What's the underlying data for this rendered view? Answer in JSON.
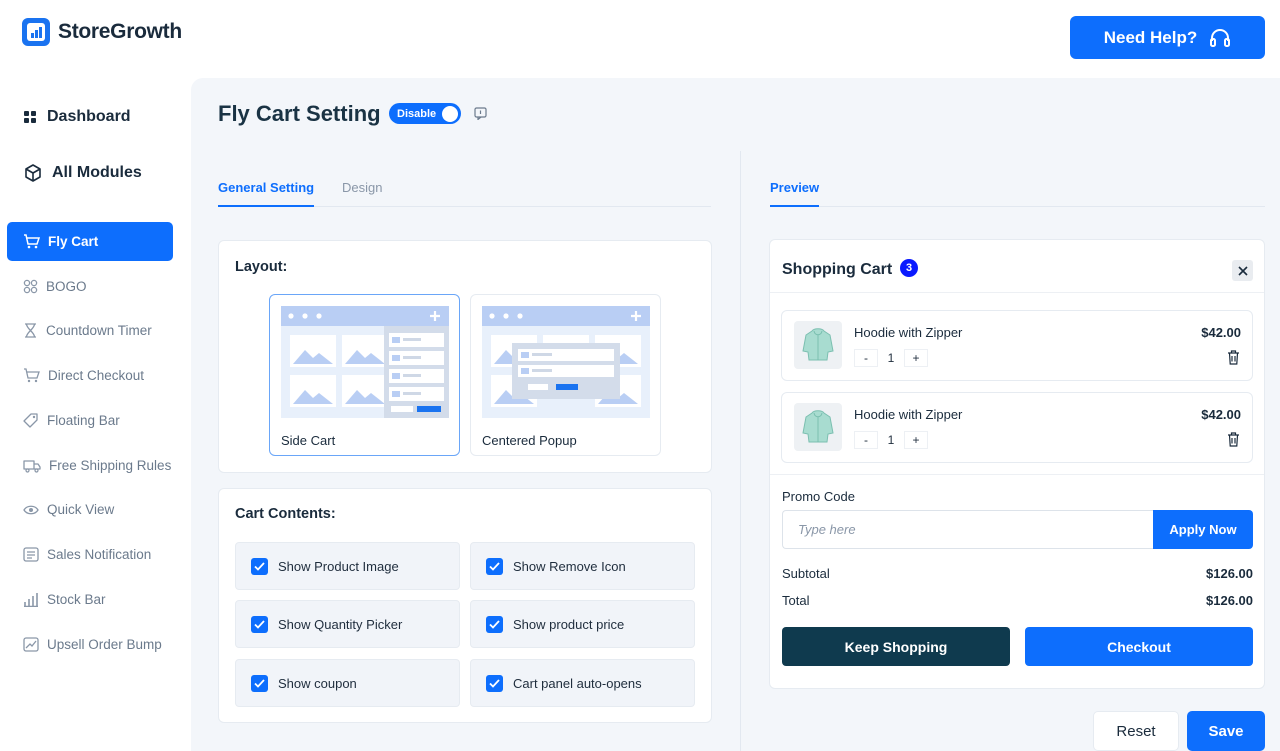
{
  "app": {
    "name": "StoreGrowth"
  },
  "header": {
    "help_label": "Need Help?"
  },
  "sidebar": {
    "dashboard": "Dashboard",
    "all_modules": "All Modules",
    "items": [
      {
        "label": "Fly Cart",
        "icon": "cart-icon",
        "active": true
      },
      {
        "label": "BOGO",
        "icon": "bogo-icon"
      },
      {
        "label": "Countdown Timer",
        "icon": "hourglass-icon"
      },
      {
        "label": "Direct Checkout",
        "icon": "checkout-cart-icon"
      },
      {
        "label": "Floating Bar",
        "icon": "tag-icon"
      },
      {
        "label": "Free Shipping Rules",
        "icon": "truck-icon"
      },
      {
        "label": "Quick View",
        "icon": "eye-icon"
      },
      {
        "label": "Sales Notification",
        "icon": "notification-icon"
      },
      {
        "label": "Stock Bar",
        "icon": "bar-chart-icon"
      },
      {
        "label": "Upsell Order Bump",
        "icon": "trend-icon"
      }
    ]
  },
  "page": {
    "title": "Fly Cart Setting",
    "toggle_label": "Disable",
    "tabs": [
      "General Setting",
      "Design"
    ],
    "preview_tab": "Preview"
  },
  "layout": {
    "title": "Layout:",
    "options": [
      "Side Cart",
      "Centered Popup"
    ],
    "selected": "Side Cart"
  },
  "cart_contents": {
    "title": "Cart Contents:",
    "options": [
      "Show Product Image",
      "Show Remove Icon",
      "Show Quantity Picker",
      "Show product price",
      "Show coupon",
      "Cart panel auto-opens"
    ]
  },
  "preview": {
    "title": "Shopping Cart",
    "count": "3",
    "items": [
      {
        "name": "Hoodie with Zipper",
        "price": "$42.00",
        "qty": "1"
      },
      {
        "name": "Hoodie with Zipper",
        "price": "$42.00",
        "qty": "1"
      }
    ],
    "promo_label": "Promo Code",
    "promo_placeholder": "Type here",
    "apply_label": "Apply Now",
    "subtotal_label": "Subtotal",
    "subtotal": "$126.00",
    "total_label": "Total",
    "total": "$126.00",
    "keep_shopping": "Keep Shopping",
    "checkout": "Checkout"
  },
  "footer": {
    "reset": "Reset",
    "save": "Save"
  },
  "colors": {
    "primary": "#0d6efd",
    "dark": "#0f3a4e",
    "badge": "#0a1aff"
  }
}
